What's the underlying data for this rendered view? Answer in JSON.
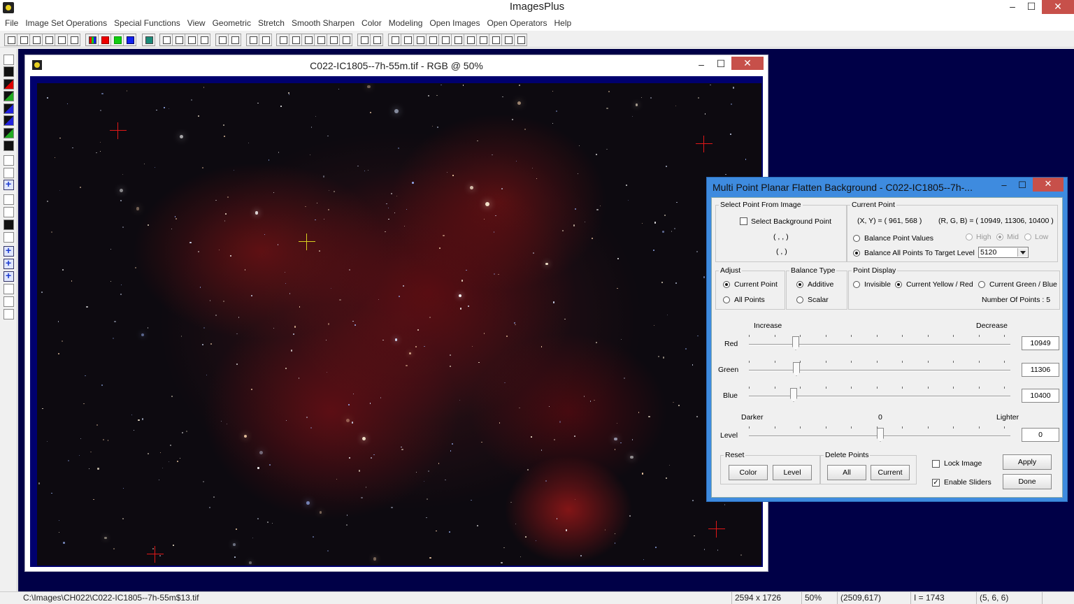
{
  "app": {
    "title": "ImagesPlus",
    "minimize": "–",
    "maximize": "☐",
    "close": "✕"
  },
  "menu": [
    "File",
    "Image Set Operations",
    "Special Functions",
    "View",
    "Geometric",
    "Stretch",
    "Smooth Sharpen",
    "Color",
    "Modeling",
    "Open Images",
    "Open Operators",
    "Help"
  ],
  "image_window": {
    "title": "C022-IC1805--7h-55m.tif - RGB @ 50%",
    "minimize": "–",
    "maximize": "☐",
    "close": "✕"
  },
  "dialog": {
    "title": "Multi Point Planar Flatten Background - C022-IC1805--7h-...",
    "minimize": "–",
    "maximize": "☐",
    "close": "✕",
    "select_point": {
      "legend": "Select Point From Image",
      "checkbox_label": "Select Background Point",
      "checked": false,
      "coord_a": "( , , )",
      "coord_b": "( , )"
    },
    "current_point": {
      "legend": "Current Point",
      "xy": "(X, Y) = ( 961, 568 )",
      "rgb": "(R, G, B) = ( 10949, 11306, 10400 )",
      "balance_point_values": "Balance Point Values",
      "high": "High",
      "mid": "Mid",
      "low": "Low",
      "balance_all": "Balance All Points To Target Level",
      "target_level": "5120"
    },
    "adjust": {
      "legend": "Adjust",
      "current_point": "Current Point",
      "all_points": "All Points"
    },
    "balance_type": {
      "legend": "Balance Type",
      "additive": "Additive",
      "scalar": "Scalar"
    },
    "point_display": {
      "legend": "Point Display",
      "invisible": "Invisible",
      "yellow_red": "Current Yellow / Red",
      "green_blue": "Current Green / Blue",
      "number_of_points": "Number Of Points : 5"
    },
    "sliders": {
      "increase": "Increase",
      "decrease": "Decrease",
      "red_label": "Red",
      "red_value": "10949",
      "green_label": "Green",
      "green_value": "11306",
      "blue_label": "Blue",
      "blue_value": "10400",
      "darker": "Darker",
      "zero": "0",
      "lighter": "Lighter",
      "level_label": "Level",
      "level_value": "0"
    },
    "reset": {
      "legend": "Reset",
      "color": "Color",
      "level": "Level"
    },
    "delete_points": {
      "legend": "Delete Points",
      "all": "All",
      "current": "Current"
    },
    "lock_image": "Lock Image",
    "enable_sliders": "Enable Sliders",
    "apply": "Apply",
    "done": "Done"
  },
  "status": {
    "path": "C:\\Images\\CH022\\C022-IC1805--7h-55m$13.tif",
    "dimensions": "2594 x 1726",
    "zoom": "50%",
    "cursor": "(2509,617)",
    "intensity": "I = 1743",
    "pixel": "(5, 6, 6)"
  },
  "colors": {
    "workspace": "#000047",
    "image_frame": "#00006e",
    "dialog_border": "#3e8bdf",
    "marker_red": "#e01818",
    "marker_yellow": "#d8d020"
  }
}
